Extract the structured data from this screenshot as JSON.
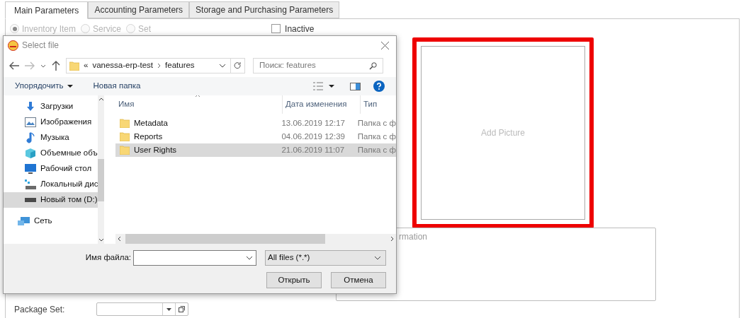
{
  "tabs": [
    {
      "label": "Main Parameters",
      "selected": true
    },
    {
      "label": "Accounting Parameters",
      "selected": false
    },
    {
      "label": "Storage and Purchasing Parameters",
      "selected": false
    }
  ],
  "item_types": [
    {
      "label": "Inventory Item",
      "selected": true,
      "disabled": true
    },
    {
      "label": "Service",
      "selected": false,
      "disabled": true
    },
    {
      "label": "Set",
      "selected": false,
      "disabled": true
    }
  ],
  "inactive": {
    "label": "Inactive",
    "checked": false
  },
  "picture": {
    "placeholder": "Add Picture",
    "highlighted": true
  },
  "information": {
    "placeholder": "rmation"
  },
  "package_set": {
    "label": "Package Set:"
  },
  "dialog": {
    "title": "Select file",
    "path": {
      "prefix": "«",
      "segments": [
        "vanessa-erp-test",
        "features"
      ]
    },
    "search": {
      "placeholder": "Поиск: features"
    },
    "toolbar": {
      "organize": "Упорядочить",
      "new_folder": "Новая папка"
    },
    "nav_items": [
      {
        "label": "Загрузки",
        "kind": "downloads",
        "selected": false
      },
      {
        "label": "Изображения",
        "kind": "pictures",
        "selected": false
      },
      {
        "label": "Музыка",
        "kind": "music",
        "selected": false
      },
      {
        "label": "Объемные объ",
        "kind": "objects",
        "selected": false
      },
      {
        "label": "Рабочий стол",
        "kind": "desktop",
        "selected": false
      },
      {
        "label": "Локальный дис",
        "kind": "drive",
        "selected": false
      },
      {
        "label": "Новый том (D:)",
        "kind": "volume",
        "selected": true
      },
      {
        "label": "Сеть",
        "kind": "network",
        "selected": false
      }
    ],
    "columns": [
      "Имя",
      "Дата изменения",
      "Тип"
    ],
    "files": [
      {
        "name": "Metadata",
        "date": "13.06.2019 12:17",
        "type": "Папка с ф",
        "selected": false
      },
      {
        "name": "Reports",
        "date": "04.06.2019 12:39",
        "type": "Папка с ф",
        "selected": false
      },
      {
        "name": "User Rights",
        "date": "21.06.2019 11:07",
        "type": "Папка с ф",
        "selected": true
      }
    ],
    "file_name_label": "Имя файла:",
    "file_type": "All files (*.*)",
    "buttons": [
      "Открыть",
      "Отмена"
    ]
  }
}
